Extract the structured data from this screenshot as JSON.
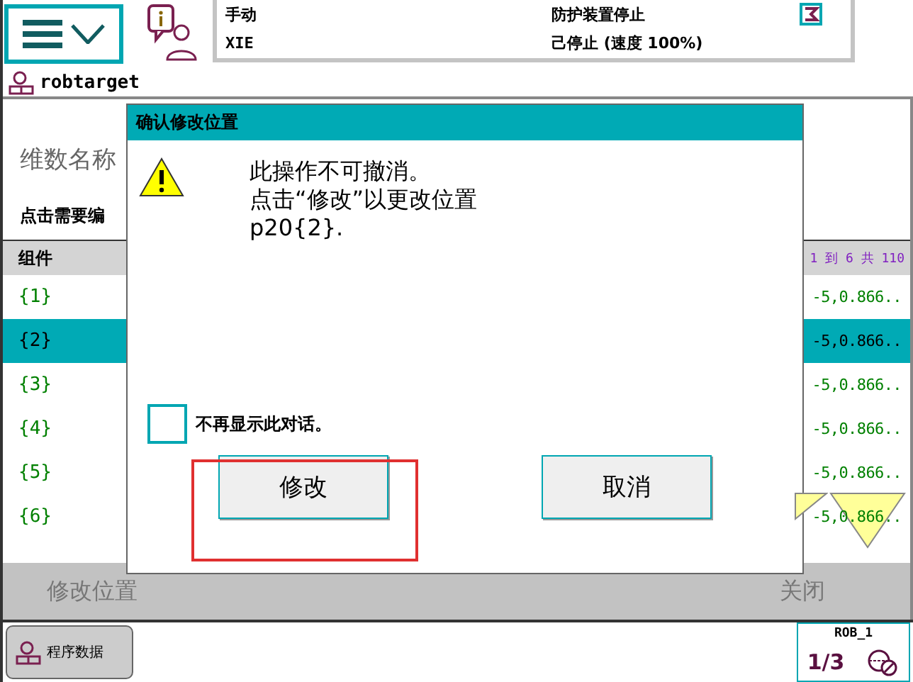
{
  "status": {
    "mode": "手动",
    "controller": "XIE",
    "safety": "防护装置停止",
    "run_state": "己停止 (速度 100%)"
  },
  "breadcrumb": "robtarget",
  "name_label": "维数名称",
  "instruction": "点击需要编",
  "table": {
    "columns": [
      "组件"
    ],
    "range": "1 到 6 共 110",
    "rows": [
      {
        "component": "{1}",
        "value": "-5,0.866..",
        "selected": false
      },
      {
        "component": "{2}",
        "value": "-5,0.866..",
        "selected": true
      },
      {
        "component": "{3}",
        "value": "-5,0.866..",
        "selected": false
      },
      {
        "component": "{4}",
        "value": "-5,0.866..",
        "selected": false
      },
      {
        "component": "{5}",
        "value": "-5,0.866..",
        "selected": false
      },
      {
        "component": "{6}",
        "value": "-5,0.866..",
        "selected": false
      }
    ]
  },
  "dialog": {
    "title": "确认修改位置",
    "lines": [
      "此操作不可撤消。",
      "点击“修改”以更改位置",
      "p20{2}."
    ],
    "checkbox": {
      "label": "不再显示此对话。",
      "checked": false
    },
    "buttons": [
      "修改",
      "取消"
    ]
  },
  "bottom_bar": [
    "修改位置",
    "关闭"
  ],
  "taskbar": {
    "button": "程序数据",
    "unit": "ROB_1",
    "fraction": "1/3"
  }
}
